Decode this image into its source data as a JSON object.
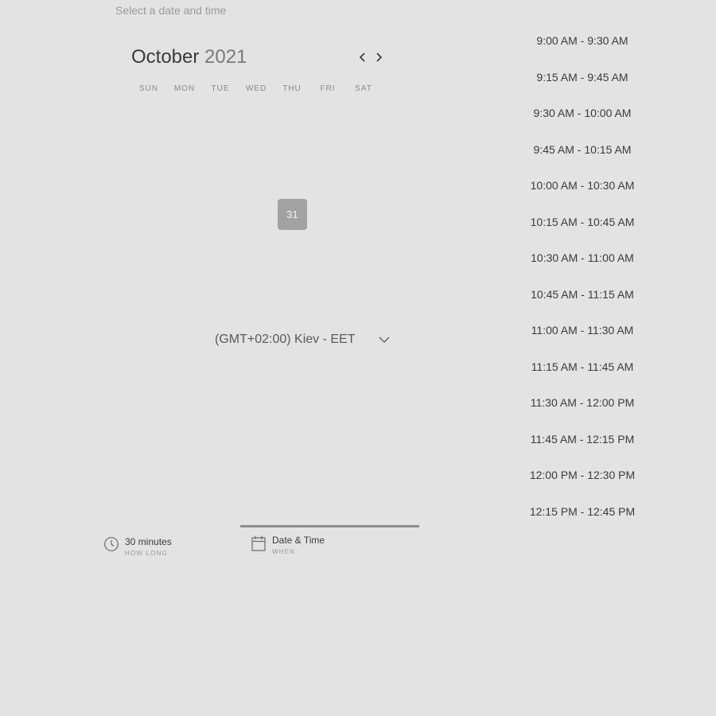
{
  "subtitle": "Select a date and time",
  "calendar": {
    "month": "October",
    "year": "2021",
    "weekdays": [
      "SUN",
      "MON",
      "TUE",
      "WED",
      "THU",
      "FRI",
      "SAT"
    ],
    "selected_day": "31"
  },
  "timezone": {
    "label": "(GMT+02:00) Kiev - EET"
  },
  "time_slots": [
    "9:00 AM - 9:30 AM",
    "9:15 AM - 9:45 AM",
    "9:30 AM - 10:00 AM",
    "9:45 AM - 10:15 AM",
    "10:00 AM - 10:30 AM",
    "10:15 AM - 10:45 AM",
    "10:30 AM - 11:00 AM",
    "10:45 AM - 11:15 AM",
    "11:00 AM - 11:30 AM",
    "11:15 AM - 11:45 AM",
    "11:30 AM - 12:00 PM",
    "11:45 AM - 12:15 PM",
    "12:00 PM - 12:30 PM",
    "12:15 PM - 12:45 PM"
  ],
  "steps": {
    "duration": {
      "title": "30 minutes",
      "sub": "HOW LONG",
      "icon": "clock-icon"
    },
    "datetime": {
      "title": "Date & Time",
      "sub": "WHEN",
      "icon": "calendar-icon"
    }
  },
  "colors": {
    "background": "#e3e3e3",
    "selected_day": "#a2a2a2",
    "active_step_bar": "#8e8e8e"
  }
}
